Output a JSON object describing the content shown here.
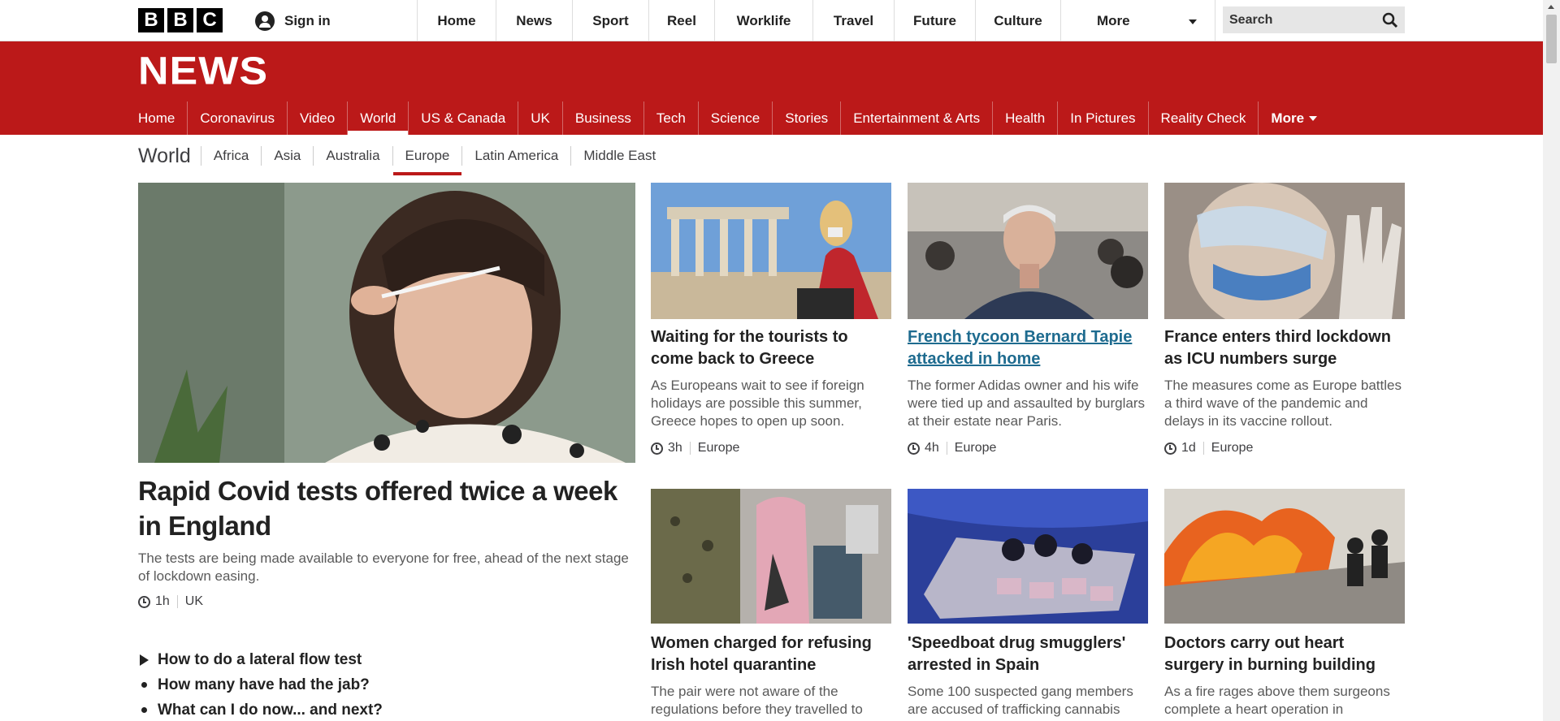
{
  "bbc_logo": [
    "B",
    "B",
    "C"
  ],
  "signin": "Sign in",
  "topnav": [
    "Home",
    "News",
    "Sport",
    "Reel",
    "Worklife",
    "Travel",
    "Future",
    "Culture",
    "More"
  ],
  "search_placeholder": "Search",
  "news_logo": "NEWS",
  "sectionnav": [
    "Home",
    "Coronavirus",
    "Video",
    "World",
    "US & Canada",
    "UK",
    "Business",
    "Tech",
    "Science",
    "Stories",
    "Entertainment & Arts",
    "Health",
    "In Pictures",
    "Reality Check",
    "More"
  ],
  "sectionnav_active": "World",
  "subnav": {
    "title": "World",
    "items": [
      "Africa",
      "Asia",
      "Australia",
      "Europe",
      "Latin America",
      "Middle East"
    ],
    "active": "Europe"
  },
  "lead": {
    "headline": "Rapid Covid tests offered twice a week in England",
    "summary": "The tests are being made available to everyone for free, ahead of the next stage of lockdown easing.",
    "time": "1h",
    "section": "UK",
    "related": [
      "How to do a lateral flow test",
      "How many have had the jab?",
      "What can I do now... and next?"
    ]
  },
  "cards": [
    {
      "headline": "Waiting for the tourists to come back to Greece",
      "summary": "As Europeans wait to see if foreign holidays are possible this summer, Greece hopes to open up soon.",
      "time": "3h",
      "section": "Europe"
    },
    {
      "headline": "French tycoon Bernard Tapie attacked in home",
      "summary": "The former Adidas owner and his wife were tied up and assaulted by burglars at their estate near Paris.",
      "time": "4h",
      "section": "Europe"
    },
    {
      "headline": "France enters third lockdown as ICU numbers surge",
      "summary": "The measures come as Europe battles a third wave of the pandemic and delays in its vaccine rollout.",
      "time": "1d",
      "section": "Europe"
    },
    {
      "headline": "Women charged for refusing Irish hotel quarantine",
      "summary": "The pair were not aware of the regulations before they travelled to"
    },
    {
      "headline": "'Speedboat drug smugglers' arrested in Spain",
      "summary": "Some 100 suspected gang members are accused of trafficking cannabis"
    },
    {
      "headline": "Doctors carry out heart surgery in burning building",
      "summary": "As a fire rages above them surgeons complete a heart operation in"
    }
  ],
  "colors": {
    "bbc_red": "#bb1919",
    "link": "#1e6b8f"
  }
}
